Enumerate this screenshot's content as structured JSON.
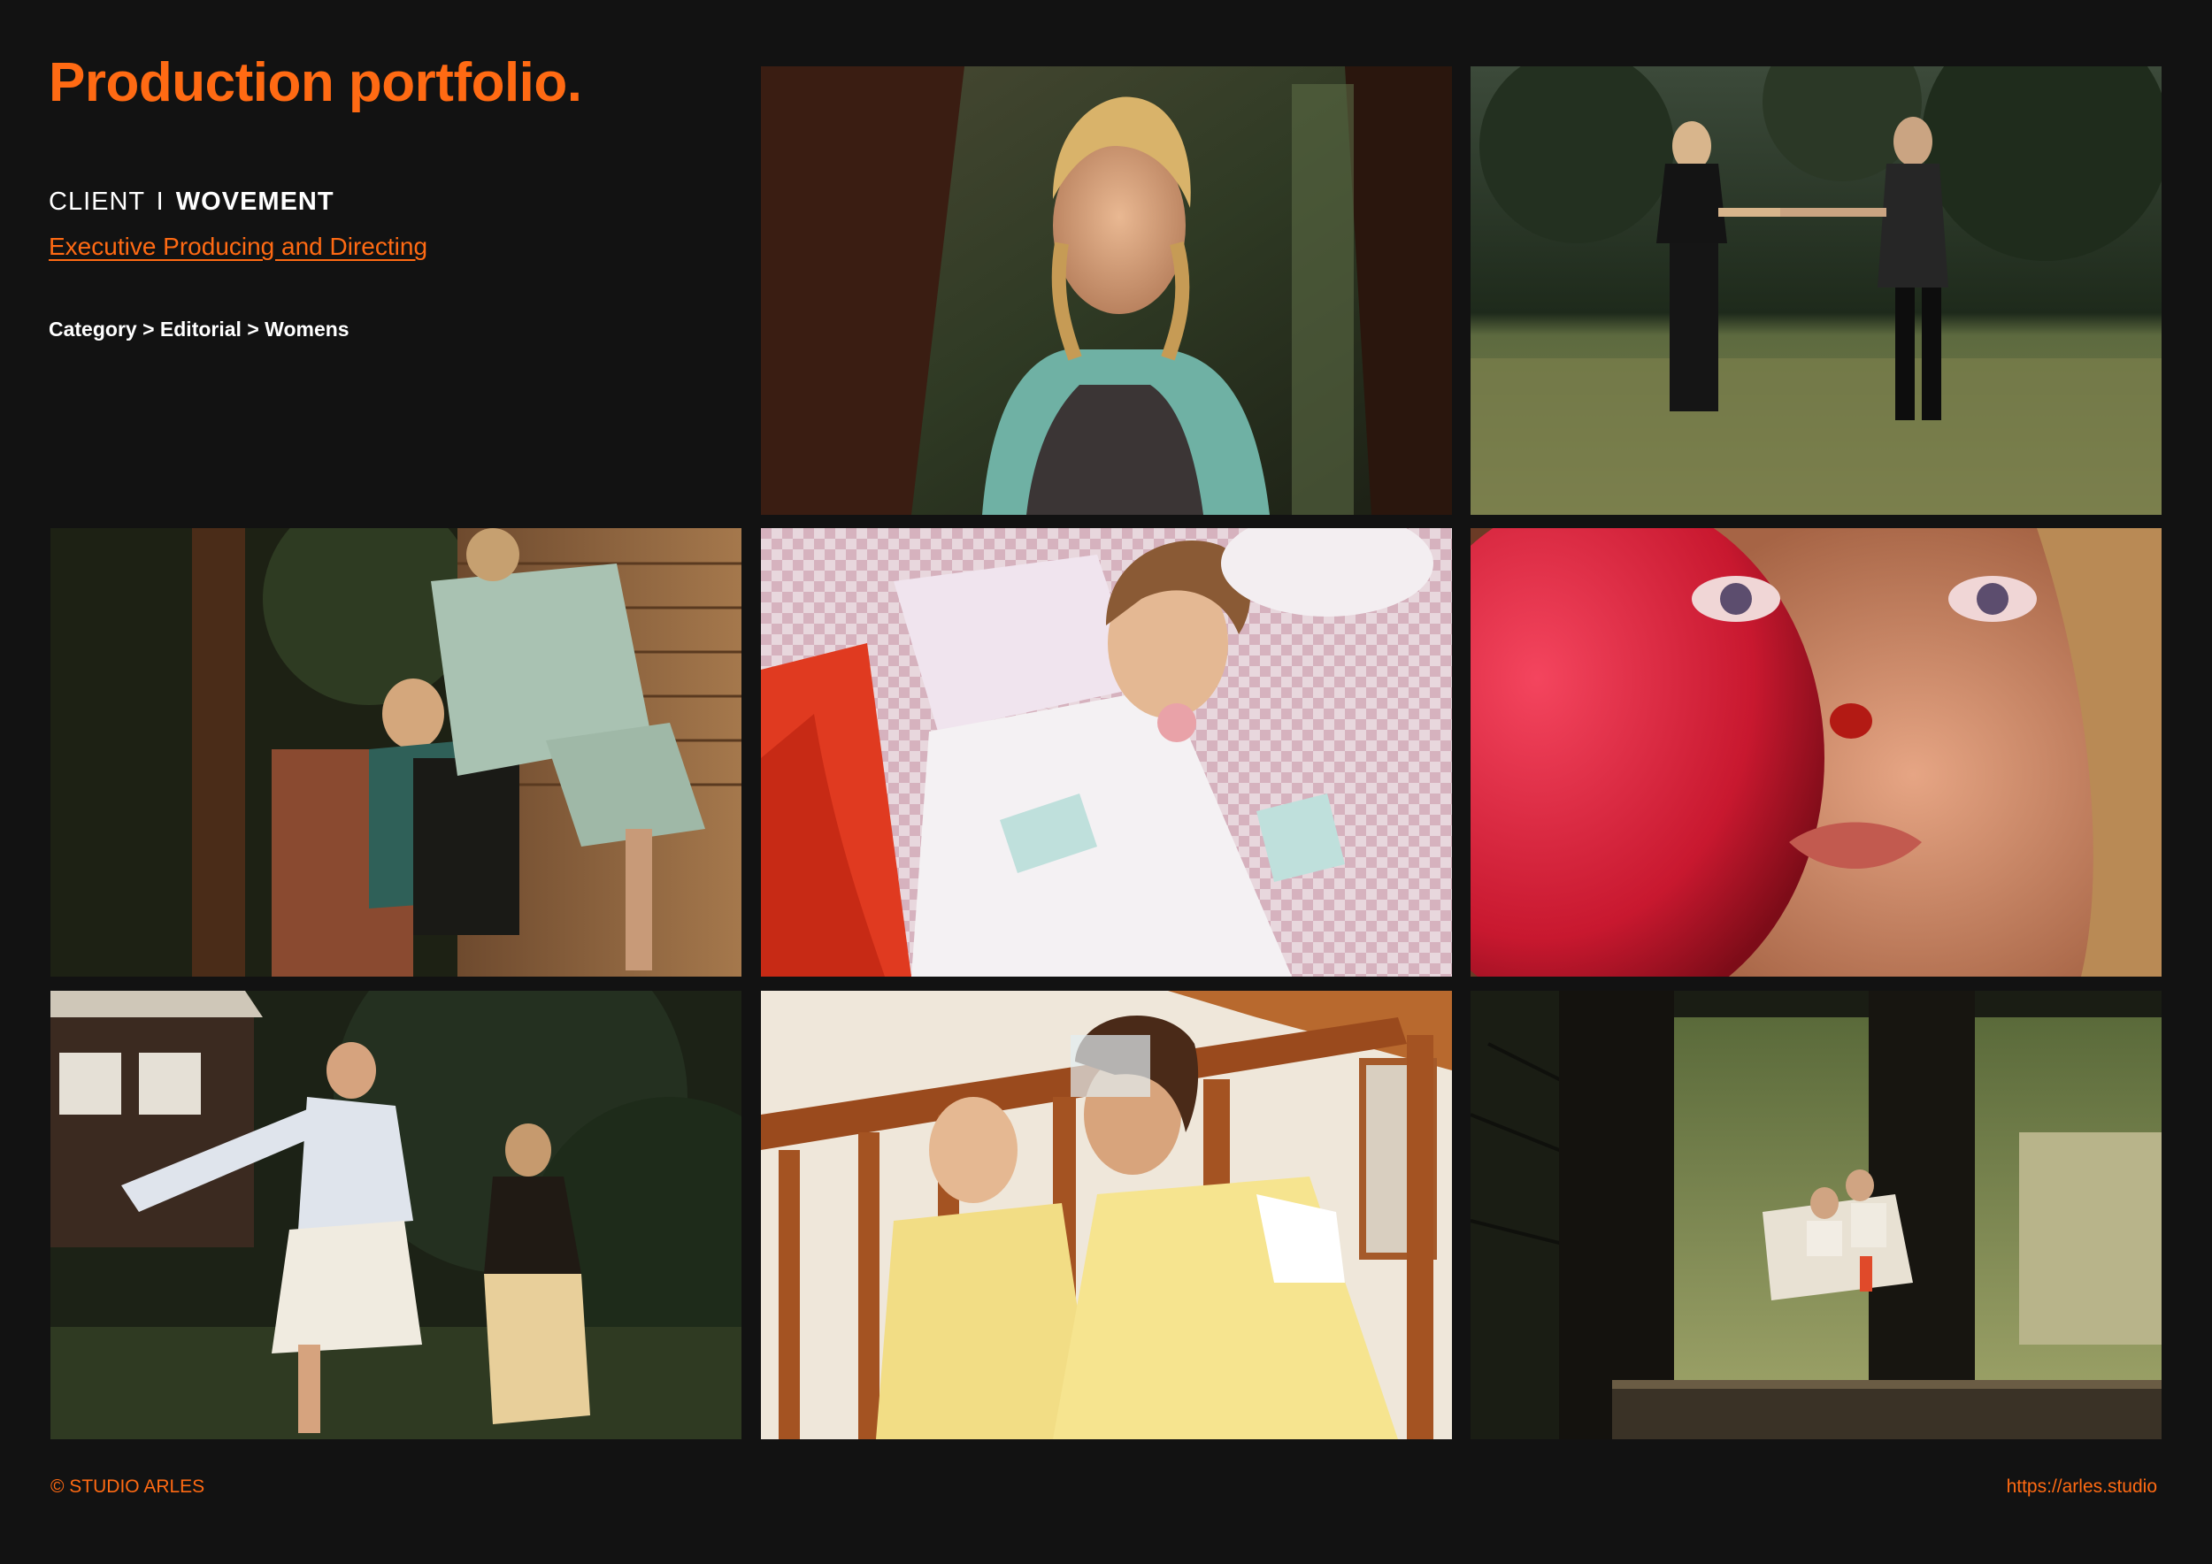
{
  "header": {
    "title": "Production portfolio.",
    "client_prefix": "CLIENT",
    "client_separator": "I",
    "client_name": "WOVEMENT",
    "service": "Executive Producing and Directing"
  },
  "breadcrumb": [
    "Category",
    ">",
    "Editorial",
    ">",
    "Womens"
  ],
  "footer": {
    "copyright": "© STUDIO ARLES",
    "url": "https://arles.studio"
  },
  "colors": {
    "accent": "#ff6a13",
    "background": "#121212",
    "text": "#ffffff"
  }
}
